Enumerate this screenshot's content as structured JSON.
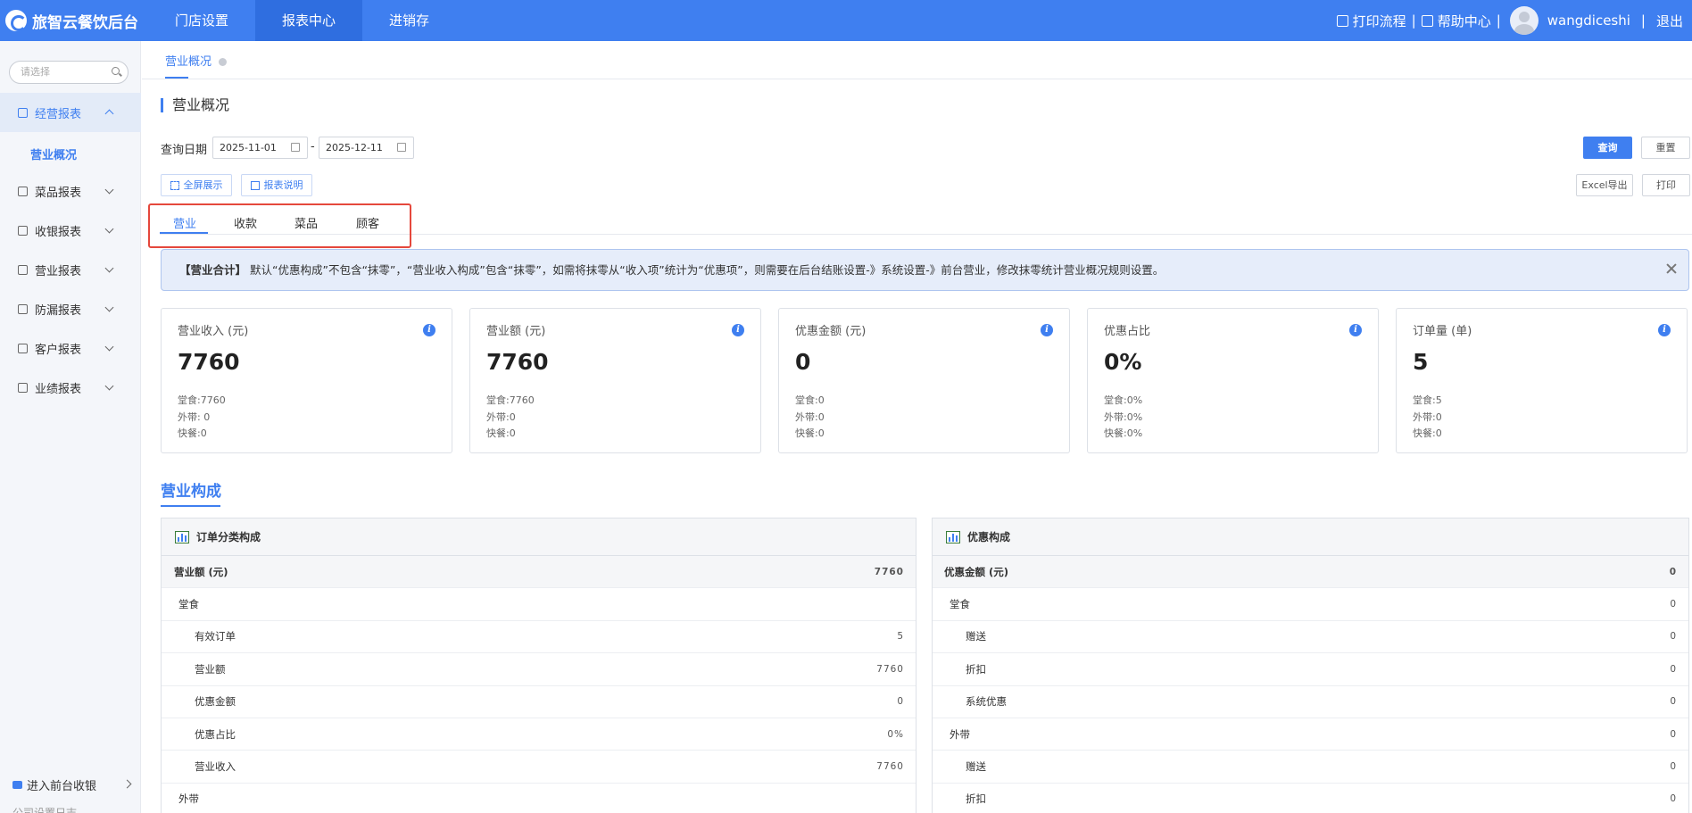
{
  "app": {
    "title": "旅智云餐饮后台"
  },
  "topnav": [
    {
      "label": "门店设置",
      "active": false
    },
    {
      "label": "报表中心",
      "active": true
    },
    {
      "label": "进销存",
      "active": false
    }
  ],
  "topright": {
    "print_flow": "打印流程",
    "help_center": "帮助中心",
    "separator": "|",
    "username": "wangdiceshi",
    "logout": "退出"
  },
  "sidebar": {
    "search_placeholder": "请选择",
    "items": [
      {
        "label": "经营报表",
        "active": true,
        "expanded": true
      },
      {
        "label": "菜品报表",
        "active": false
      },
      {
        "label": "收银报表",
        "active": false
      },
      {
        "label": "营业报表",
        "active": false
      },
      {
        "label": "防漏报表",
        "active": false
      },
      {
        "label": "客户报表",
        "active": false
      },
      {
        "label": "业绩报表",
        "active": false
      }
    ],
    "sub_active": "营业概况",
    "bottom_link": "进入前台收银",
    "cut_text": "公司设置日志"
  },
  "page_tab": "营业概况",
  "section_title": "营业概况",
  "query": {
    "date_label": "查询日期",
    "start_date": "2025-11-01",
    "end_date": "2025-12-11",
    "dash": "-",
    "query_button": "查询",
    "reset_button": "重置",
    "fullscreen_button": "全屏展示",
    "report_desc_button": "报表说明",
    "excel_button": "Excel导出",
    "print_button": "打印"
  },
  "report_tabs": [
    {
      "label": "营业",
      "active": true
    },
    {
      "label": "收款",
      "active": false
    },
    {
      "label": "菜品",
      "active": false
    },
    {
      "label": "顾客",
      "active": false
    }
  ],
  "notice": {
    "title": "【营业合计】",
    "text": "默认“优惠构成”不包含“抹零”，“营业收入构成”包含“抹零”，如需将抹零从“收入项”统计为“优惠项”，则需要在后台结账设置-》系统设置-》前台营业，修改抹零统计营业概况规则设置。"
  },
  "cards": [
    {
      "title": "营业收入 (元)",
      "value": "7760",
      "lines": [
        "堂食:7760",
        "外带: 0",
        "快餐:0"
      ]
    },
    {
      "title": "营业额 (元)",
      "value": "7760",
      "lines": [
        "堂食:7760",
        "外带:0",
        "快餐:0"
      ]
    },
    {
      "title": "优惠金额 (元)",
      "value": "0",
      "lines": [
        "堂食:0",
        "外带:0",
        "快餐:0"
      ]
    },
    {
      "title": "优惠占比",
      "value": "0%",
      "lines": [
        "堂食:0%",
        "外带:0%",
        "快餐:0%"
      ]
    },
    {
      "title": "订单量 (单)",
      "value": "5",
      "lines": [
        "堂食:5",
        "外带:0",
        "快餐:0"
      ]
    }
  ],
  "composition_title": "营业构成",
  "order_panel": {
    "title": "订单分类构成",
    "rows": [
      {
        "label": "营业额 (元)",
        "value": "7760",
        "level": 0
      },
      {
        "label": "堂食",
        "value": "",
        "level": 1
      },
      {
        "label": "有效订单",
        "value": "5",
        "level": 2
      },
      {
        "label": "营业额",
        "value": "7760",
        "level": 2
      },
      {
        "label": "优惠金额",
        "value": "0",
        "level": 2
      },
      {
        "label": "优惠占比",
        "value": "0%",
        "level": 2
      },
      {
        "label": "营业收入",
        "value": "7760",
        "level": 2
      },
      {
        "label": "外带",
        "value": "",
        "level": 1
      }
    ]
  },
  "discount_panel": {
    "title": "优惠构成",
    "rows": [
      {
        "label": "优惠金额 (元)",
        "value": "0",
        "level": 0
      },
      {
        "label": "堂食",
        "value": "0",
        "level": 1
      },
      {
        "label": "赠送",
        "value": "0",
        "level": 2
      },
      {
        "label": "折扣",
        "value": "0",
        "level": 2
      },
      {
        "label": "系统优惠",
        "value": "0",
        "level": 2
      },
      {
        "label": "外带",
        "value": "0",
        "level": 1
      },
      {
        "label": "赠送",
        "value": "0",
        "level": 2
      },
      {
        "label": "折扣",
        "value": "0",
        "level": 2
      }
    ]
  }
}
